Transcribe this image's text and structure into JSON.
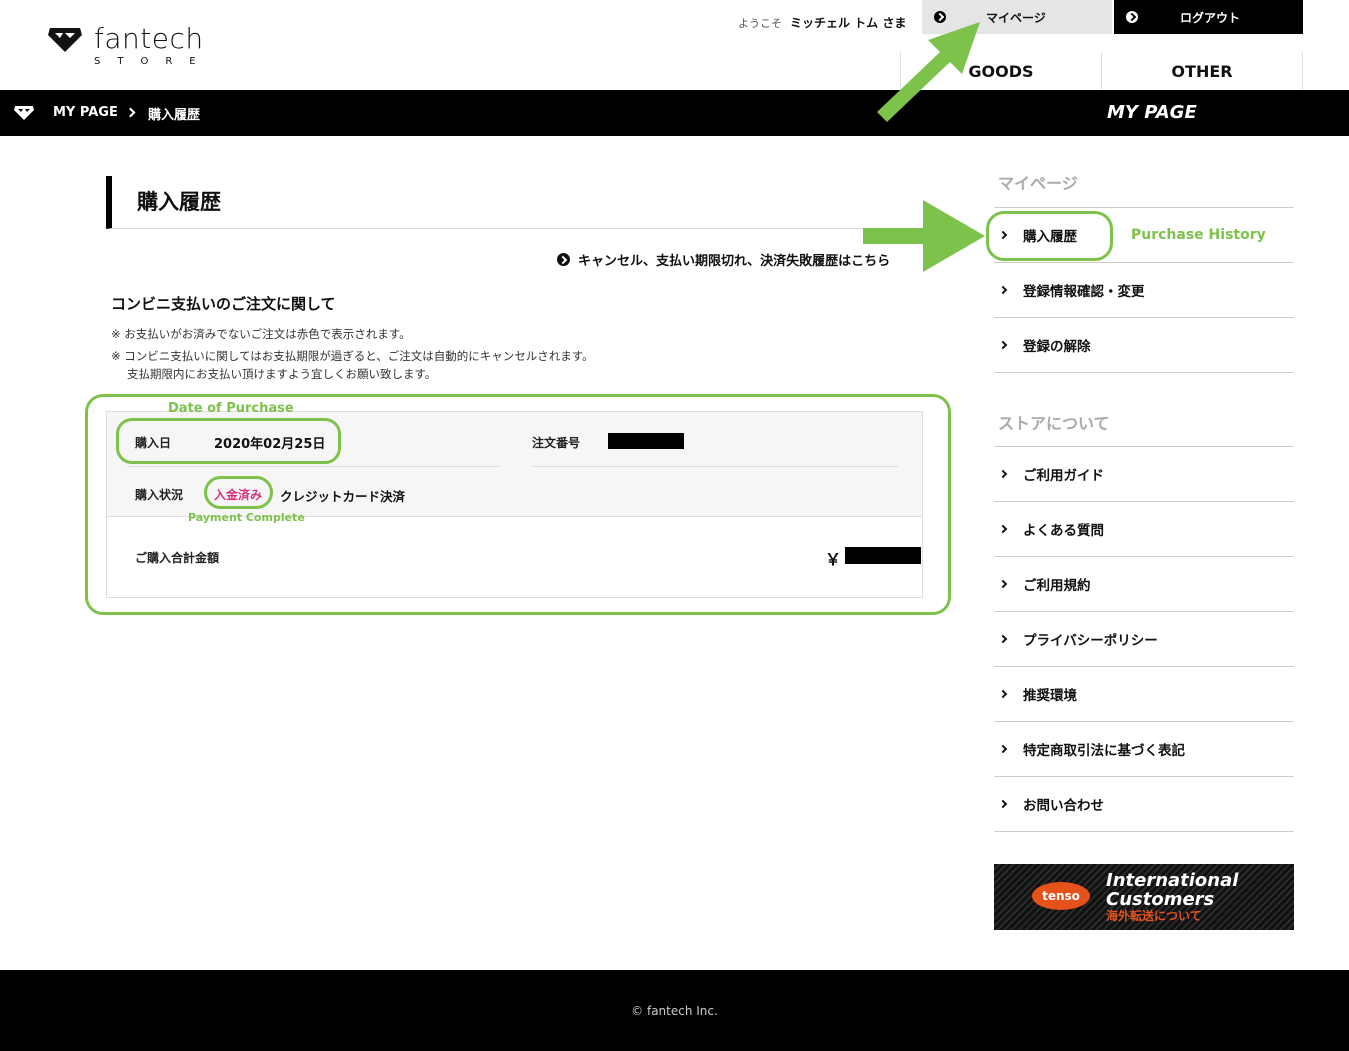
{
  "brand": {
    "name": "fantech",
    "sub": "STORE"
  },
  "header": {
    "welcome_prefix": "ようこそ",
    "user_name": "ミッチェル トム さま",
    "mypage_label": "マイページ",
    "logout_label": "ログアウト",
    "nav": [
      "GOODS",
      "OTHER"
    ]
  },
  "breadcrumb": {
    "items": [
      "MY PAGE",
      "購入履歴"
    ],
    "section_title": "MY PAGE"
  },
  "main": {
    "page_title": "購入履歴",
    "cancel_link": "キャンセル、支払い期限切れ、決済失敗履歴はこちら",
    "notice_title": "コンビニ支払いのご注文に関して",
    "notes": [
      "※ お支払いがお済みでないご注文は赤色で表示されます。",
      "※ コンビニ支払いに関してはお支払期限が過ぎると、ご注文は自動的にキャンセルされます。",
      "支払期限内にお支払い頂けますよう宜しくお願い致します。"
    ],
    "order": {
      "date_label": "購入日",
      "date": "2020年02月25日",
      "number_label": "注文番号",
      "status_label": "購入状況",
      "status": "入金済み",
      "payment_method": "クレジットカード決済",
      "total_label": "ご購入合計金額",
      "currency": "￥"
    }
  },
  "sidebar": {
    "mypage_heading": "マイページ",
    "mypage_items": [
      "購入履歴",
      "登録情報確認・変更",
      "登録の解除"
    ],
    "store_heading": "ストアについて",
    "store_items": [
      "ご利用ガイド",
      "よくある質問",
      "ご利用規約",
      "プライバシーポリシー",
      "推奨環境",
      "特定商取引法に基づく表記",
      "お問い合わせ"
    ],
    "banner": {
      "badge": "tenso",
      "line1": "International",
      "line2": "Customers",
      "line3": "海外転送について"
    }
  },
  "footer": {
    "copyright": "© fantech Inc."
  },
  "annotations": {
    "date_of_purchase": "Date of Purchase",
    "payment_complete": "Payment Complete",
    "purchase_history": "Purchase History",
    "color": "#7dc24b"
  },
  "colors": {
    "paid_status": "#d6307a",
    "annotation": "#7dc24b",
    "banner_accent": "#e5521b"
  }
}
